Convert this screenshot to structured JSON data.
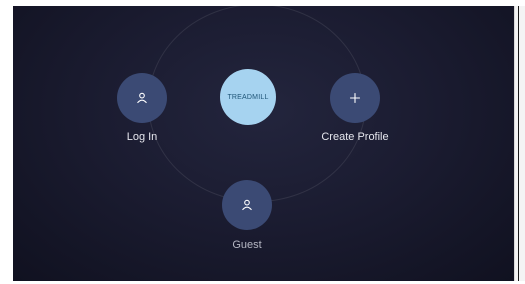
{
  "screen": {
    "center_button": {
      "label": "TREADMILL"
    },
    "options": [
      {
        "id": "login",
        "label": "Log In",
        "icon": "user-icon"
      },
      {
        "id": "create-profile",
        "label": "Create Profile",
        "icon": "plus-icon"
      },
      {
        "id": "guest",
        "label": "Guest",
        "icon": "user-icon"
      }
    ]
  },
  "colors": {
    "background": "#1b1c31",
    "option_button": "#3b4a74",
    "center_button": "#a6d3f0"
  }
}
